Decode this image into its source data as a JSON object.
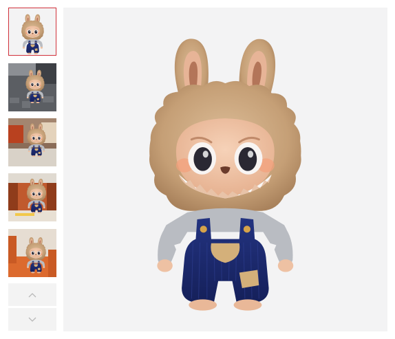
{
  "gallery": {
    "thumbnails": [
      {
        "name": "thumbnail-1",
        "scene": "white-background",
        "selected": true
      },
      {
        "name": "thumbnail-2",
        "scene": "outdoor-pavement",
        "selected": false
      },
      {
        "name": "thumbnail-3",
        "scene": "storefront",
        "selected": false
      },
      {
        "name": "thumbnail-4",
        "scene": "table-with-shelf",
        "selected": false
      },
      {
        "name": "thumbnail-5",
        "scene": "orange-furniture",
        "selected": false
      }
    ],
    "nav": {
      "prev_icon": "chevron-up-icon",
      "next_icon": "chevron-down-icon"
    },
    "main_image": {
      "subject": "plush-figure-in-blue-overalls"
    }
  },
  "colors": {
    "selected_border": "#d0303a",
    "main_background": "#f3f3f4",
    "nav_background": "#f3f3f3",
    "fur": "#c9a57e",
    "face": "#eec1a3",
    "overalls": "#1d2c6e",
    "shirt": "#b9bcc2",
    "pocket": "#d4b07a"
  }
}
